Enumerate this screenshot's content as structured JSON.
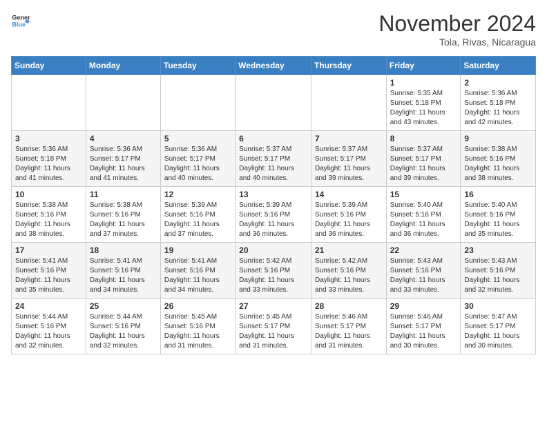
{
  "header": {
    "logo_general": "General",
    "logo_blue": "Blue",
    "month": "November 2024",
    "location": "Tola, Rivas, Nicaragua"
  },
  "calendar": {
    "days_of_week": [
      "Sunday",
      "Monday",
      "Tuesday",
      "Wednesday",
      "Thursday",
      "Friday",
      "Saturday"
    ],
    "weeks": [
      [
        {
          "day": "",
          "info": ""
        },
        {
          "day": "",
          "info": ""
        },
        {
          "day": "",
          "info": ""
        },
        {
          "day": "",
          "info": ""
        },
        {
          "day": "",
          "info": ""
        },
        {
          "day": "1",
          "info": "Sunrise: 5:35 AM\nSunset: 5:18 PM\nDaylight: 11 hours and 43 minutes."
        },
        {
          "day": "2",
          "info": "Sunrise: 5:36 AM\nSunset: 5:18 PM\nDaylight: 11 hours and 42 minutes."
        }
      ],
      [
        {
          "day": "3",
          "info": "Sunrise: 5:36 AM\nSunset: 5:18 PM\nDaylight: 11 hours and 41 minutes."
        },
        {
          "day": "4",
          "info": "Sunrise: 5:36 AM\nSunset: 5:17 PM\nDaylight: 11 hours and 41 minutes."
        },
        {
          "day": "5",
          "info": "Sunrise: 5:36 AM\nSunset: 5:17 PM\nDaylight: 11 hours and 40 minutes."
        },
        {
          "day": "6",
          "info": "Sunrise: 5:37 AM\nSunset: 5:17 PM\nDaylight: 11 hours and 40 minutes."
        },
        {
          "day": "7",
          "info": "Sunrise: 5:37 AM\nSunset: 5:17 PM\nDaylight: 11 hours and 39 minutes."
        },
        {
          "day": "8",
          "info": "Sunrise: 5:37 AM\nSunset: 5:17 PM\nDaylight: 11 hours and 39 minutes."
        },
        {
          "day": "9",
          "info": "Sunrise: 5:38 AM\nSunset: 5:16 PM\nDaylight: 11 hours and 38 minutes."
        }
      ],
      [
        {
          "day": "10",
          "info": "Sunrise: 5:38 AM\nSunset: 5:16 PM\nDaylight: 11 hours and 38 minutes."
        },
        {
          "day": "11",
          "info": "Sunrise: 5:38 AM\nSunset: 5:16 PM\nDaylight: 11 hours and 37 minutes."
        },
        {
          "day": "12",
          "info": "Sunrise: 5:39 AM\nSunset: 5:16 PM\nDaylight: 11 hours and 37 minutes."
        },
        {
          "day": "13",
          "info": "Sunrise: 5:39 AM\nSunset: 5:16 PM\nDaylight: 11 hours and 36 minutes."
        },
        {
          "day": "14",
          "info": "Sunrise: 5:39 AM\nSunset: 5:16 PM\nDaylight: 11 hours and 36 minutes."
        },
        {
          "day": "15",
          "info": "Sunrise: 5:40 AM\nSunset: 5:16 PM\nDaylight: 11 hours and 36 minutes."
        },
        {
          "day": "16",
          "info": "Sunrise: 5:40 AM\nSunset: 5:16 PM\nDaylight: 11 hours and 35 minutes."
        }
      ],
      [
        {
          "day": "17",
          "info": "Sunrise: 5:41 AM\nSunset: 5:16 PM\nDaylight: 11 hours and 35 minutes."
        },
        {
          "day": "18",
          "info": "Sunrise: 5:41 AM\nSunset: 5:16 PM\nDaylight: 11 hours and 34 minutes."
        },
        {
          "day": "19",
          "info": "Sunrise: 5:41 AM\nSunset: 5:16 PM\nDaylight: 11 hours and 34 minutes."
        },
        {
          "day": "20",
          "info": "Sunrise: 5:42 AM\nSunset: 5:16 PM\nDaylight: 11 hours and 33 minutes."
        },
        {
          "day": "21",
          "info": "Sunrise: 5:42 AM\nSunset: 5:16 PM\nDaylight: 11 hours and 33 minutes."
        },
        {
          "day": "22",
          "info": "Sunrise: 5:43 AM\nSunset: 5:16 PM\nDaylight: 11 hours and 33 minutes."
        },
        {
          "day": "23",
          "info": "Sunrise: 5:43 AM\nSunset: 5:16 PM\nDaylight: 11 hours and 32 minutes."
        }
      ],
      [
        {
          "day": "24",
          "info": "Sunrise: 5:44 AM\nSunset: 5:16 PM\nDaylight: 11 hours and 32 minutes."
        },
        {
          "day": "25",
          "info": "Sunrise: 5:44 AM\nSunset: 5:16 PM\nDaylight: 11 hours and 32 minutes."
        },
        {
          "day": "26",
          "info": "Sunrise: 5:45 AM\nSunset: 5:16 PM\nDaylight: 11 hours and 31 minutes."
        },
        {
          "day": "27",
          "info": "Sunrise: 5:45 AM\nSunset: 5:17 PM\nDaylight: 11 hours and 31 minutes."
        },
        {
          "day": "28",
          "info": "Sunrise: 5:46 AM\nSunset: 5:17 PM\nDaylight: 11 hours and 31 minutes."
        },
        {
          "day": "29",
          "info": "Sunrise: 5:46 AM\nSunset: 5:17 PM\nDaylight: 11 hours and 30 minutes."
        },
        {
          "day": "30",
          "info": "Sunrise: 5:47 AM\nSunset: 5:17 PM\nDaylight: 11 hours and 30 minutes."
        }
      ]
    ]
  }
}
